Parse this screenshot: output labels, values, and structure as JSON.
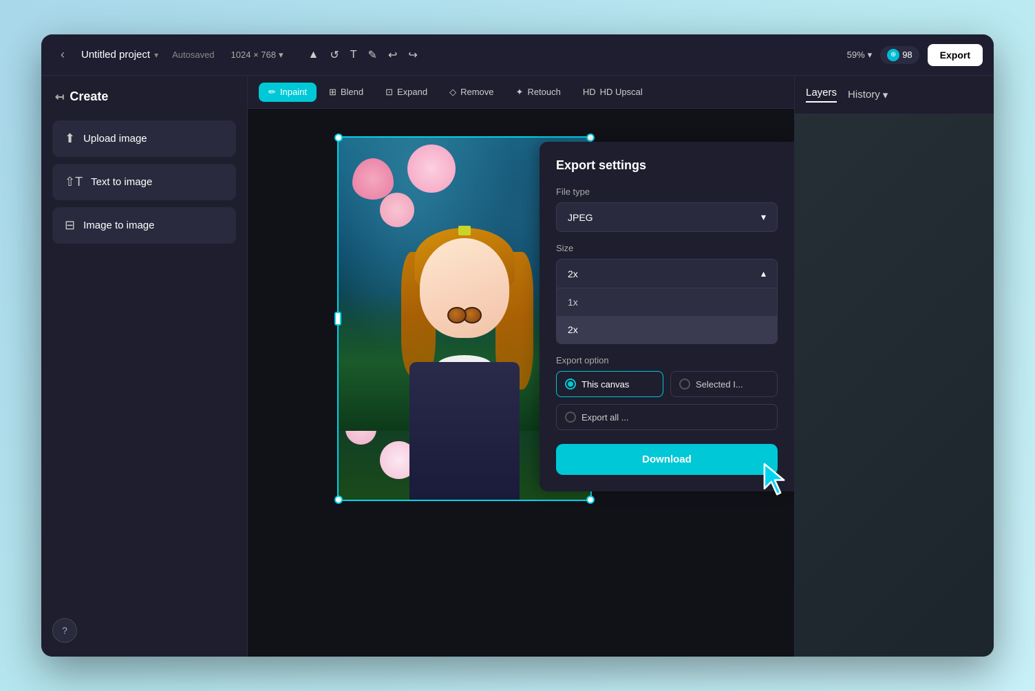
{
  "app": {
    "title": "Untitled project",
    "autosaved": "Autosaved",
    "dimensions": "1024 × 768",
    "zoom": "59%",
    "credits": "98",
    "export_btn": "Export",
    "back_btn": "←"
  },
  "toolbar": {
    "tools": [
      "▲",
      "↺",
      "T",
      "✏",
      "↩",
      "↪"
    ]
  },
  "sidebar": {
    "create_label": "Create",
    "items": [
      {
        "icon": "⬆",
        "label": "Upload image"
      },
      {
        "icon": "T",
        "label": "Text to image"
      },
      {
        "icon": "🖼",
        "label": "Image to image"
      }
    ],
    "help_icon": "?"
  },
  "canvas_toolbar": {
    "tools": [
      {
        "label": "Inpaint",
        "active": true,
        "icon": "✏"
      },
      {
        "label": "Blend",
        "active": false,
        "icon": "⊞"
      },
      {
        "label": "Expand",
        "active": false,
        "icon": "⊡"
      },
      {
        "label": "Remove",
        "active": false,
        "icon": "◇"
      },
      {
        "label": "Retouch",
        "active": false,
        "icon": "✦"
      },
      {
        "label": "HD Upscal",
        "active": false,
        "icon": "HD"
      }
    ]
  },
  "right_panel": {
    "layers_label": "Layers",
    "history_label": "History"
  },
  "export_settings": {
    "title": "Export settings",
    "file_type_label": "File type",
    "file_type_value": "JPEG",
    "size_label": "Size",
    "size_value": "2x",
    "size_options": [
      "1x",
      "2x"
    ],
    "export_option_label": "Export option",
    "option_canvas": "This canvas",
    "option_selected": "Selected I...",
    "option_export_all": "Export all ...",
    "download_btn": "Download"
  }
}
